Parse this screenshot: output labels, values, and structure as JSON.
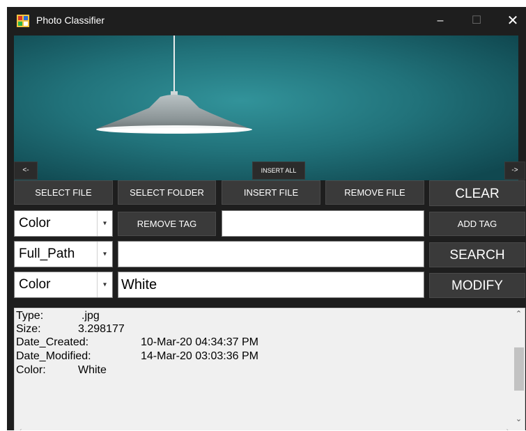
{
  "window": {
    "title": "Photo Classifier",
    "minimize_glyph": "–",
    "maximize_glyph": "☐",
    "close_glyph": "✕"
  },
  "viewer": {
    "prev_label": "<-",
    "insert_all_label": "INSERT ALL",
    "next_label": "->"
  },
  "buttons": {
    "select_file": "SELECT FILE",
    "select_folder": "SELECT FOLDER",
    "insert_file": "INSERT FILE",
    "remove_file": "REMOVE FILE",
    "clear": "CLEAR",
    "remove_tag": "REMOVE TAG",
    "add_tag": "ADD TAG",
    "search": "SEARCH",
    "modify": "MODIFY"
  },
  "tag_row": {
    "combo_value": "Color",
    "input_value": ""
  },
  "search_row": {
    "combo_value": "Full_Path",
    "input_value": ""
  },
  "modify_row": {
    "combo_value": "Color",
    "input_value": "White"
  },
  "info": {
    "type_label": "Type:",
    "type_value": ".jpg",
    "size_label": "Size:",
    "size_value": "3.298177",
    "created_label": "Date_Created:",
    "created_value": "10-Mar-20 04:34:37 PM",
    "modified_label": "Date_Modified:",
    "modified_value": "14-Mar-20 03:03:36 PM",
    "color_label": "Color:",
    "color_value": "White"
  },
  "icons": {
    "app": "app-icon",
    "dropdown": "chevron-down-icon",
    "scroll_up": "chevron-up-icon",
    "scroll_down": "chevron-down-icon",
    "scroll_left": "chevron-left-icon",
    "scroll_right": "chevron-right-icon"
  },
  "colors": {
    "titlebar": "#1e1e1e",
    "button": "#3a3a3a",
    "viewer_bg": "#1f6f77",
    "info_bg": "#f0f0f0"
  }
}
